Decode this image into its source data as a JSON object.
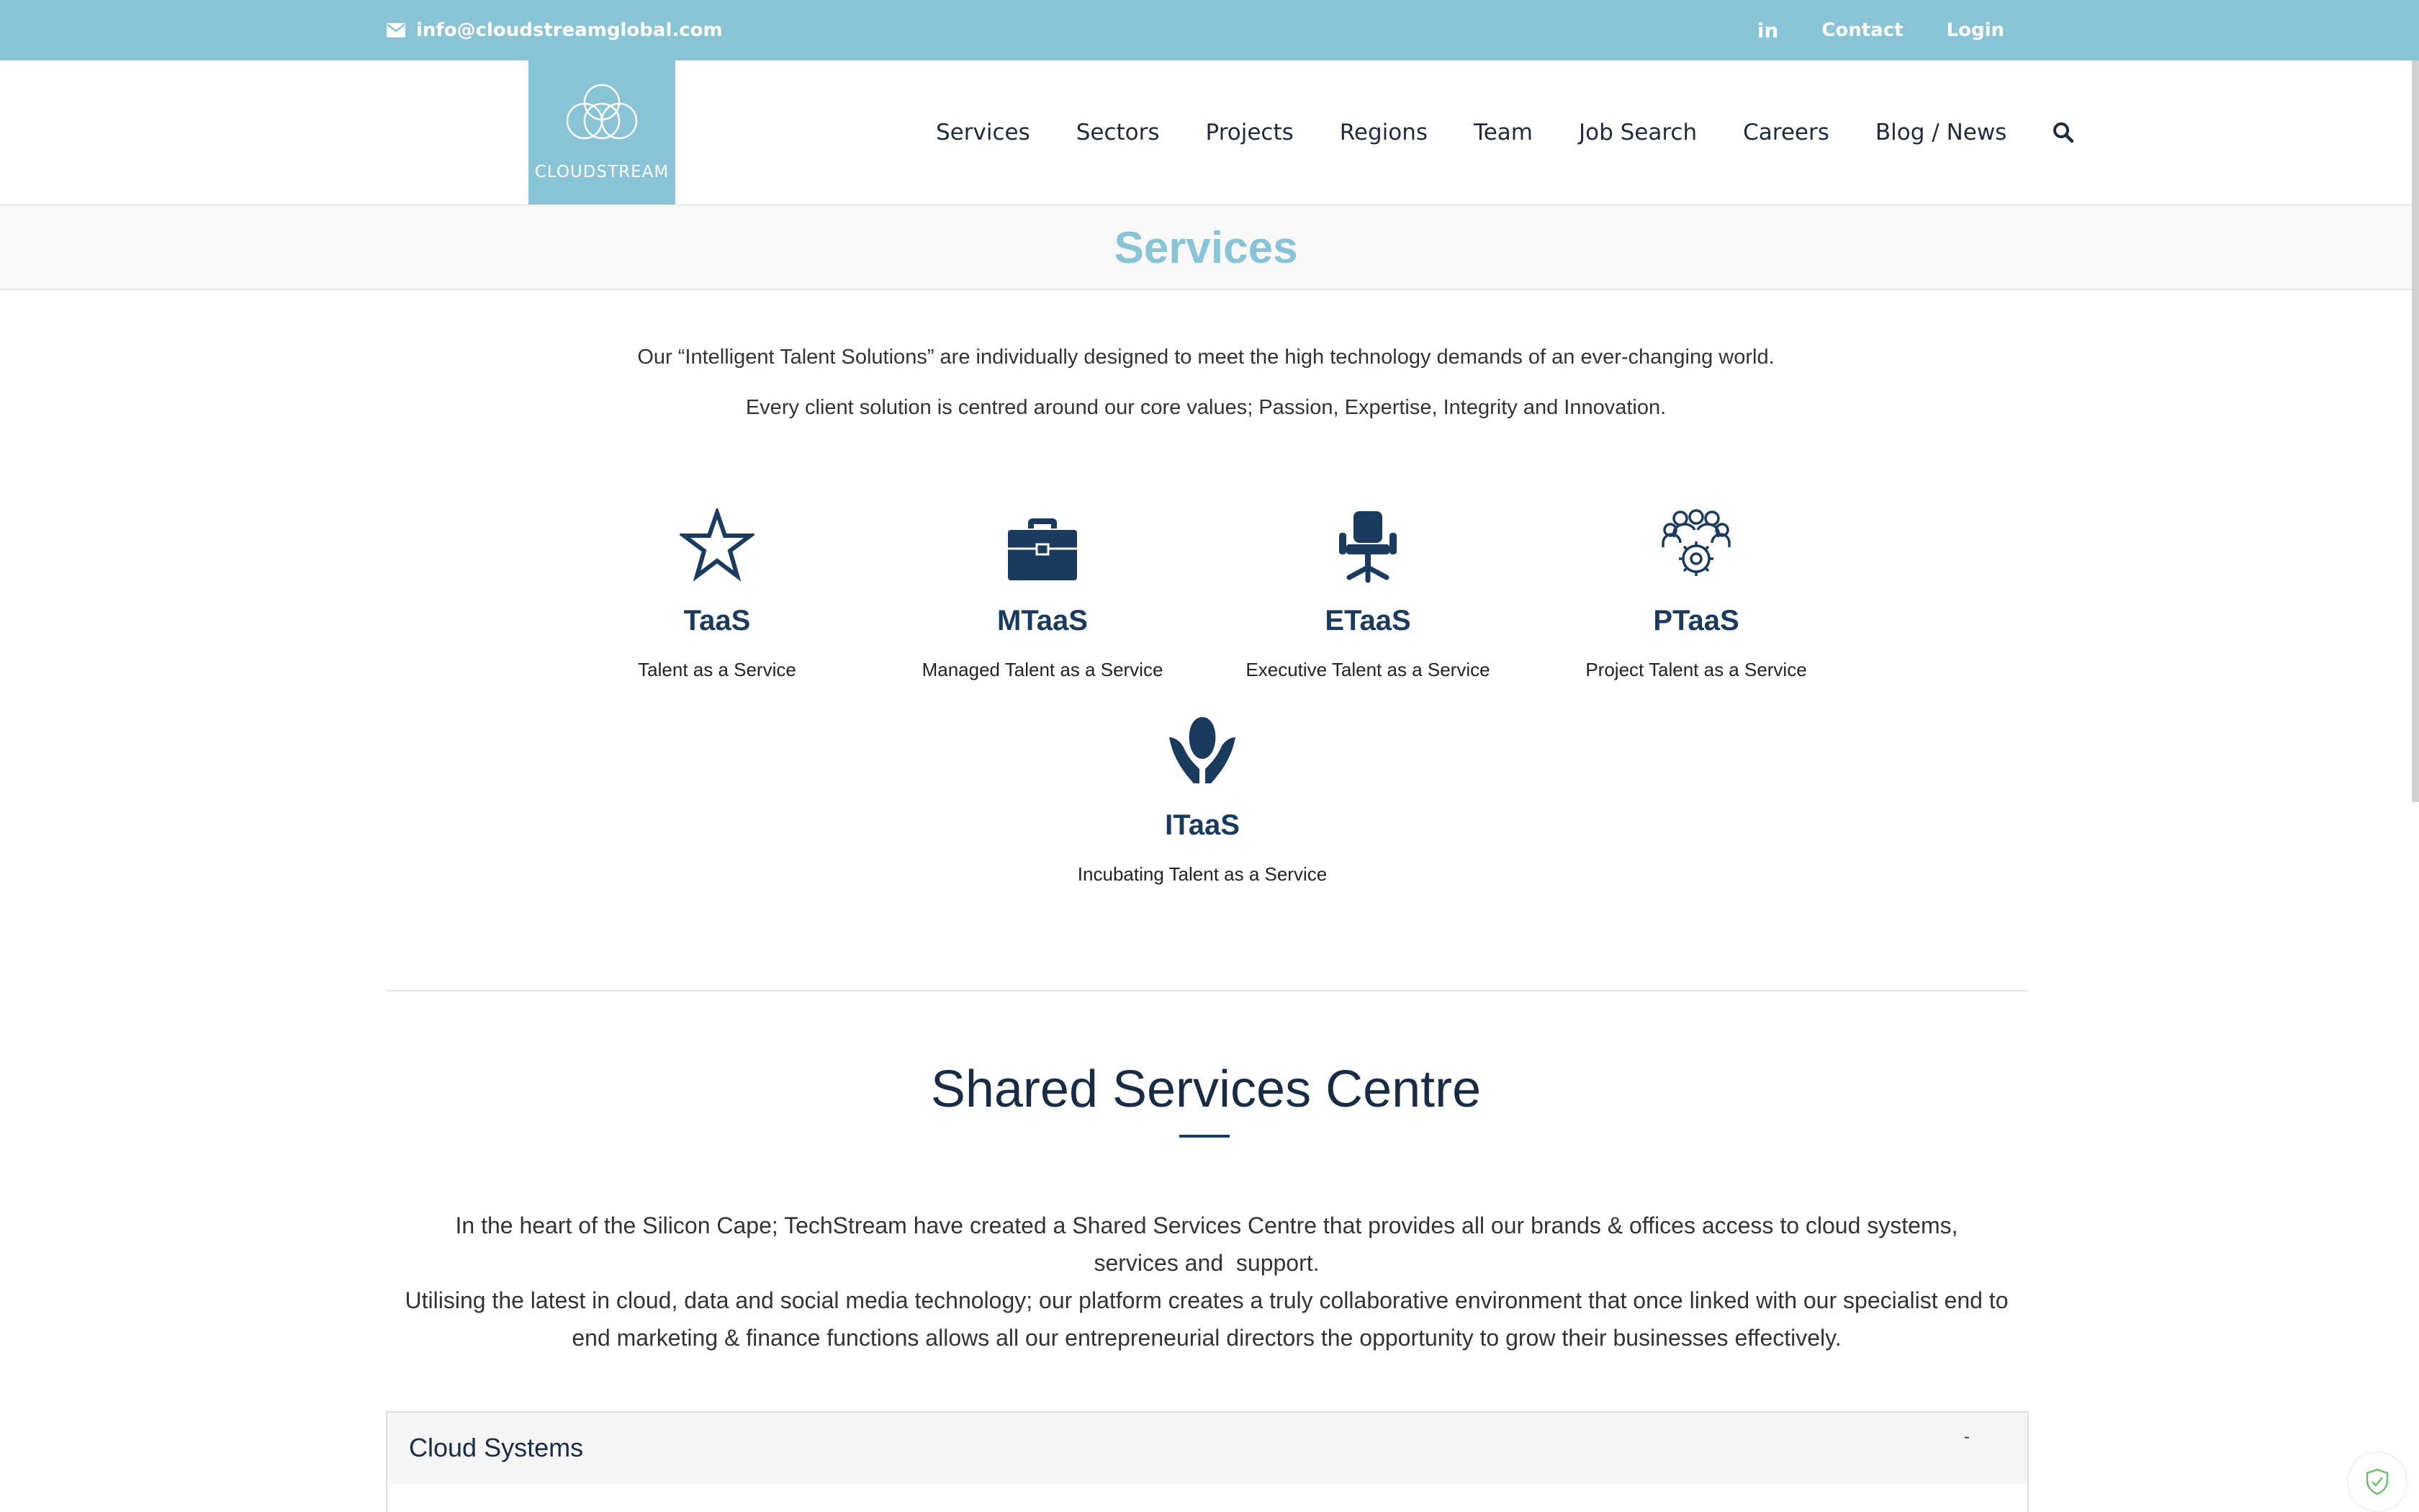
{
  "topbar": {
    "email": "info@cloudstreamglobal.com",
    "linkedin": "in",
    "contact": "Contact",
    "login": "Login"
  },
  "logo": {
    "text": "CLOUDSTREAM"
  },
  "nav": {
    "items": [
      "Services",
      "Sectors",
      "Projects",
      "Regions",
      "Team",
      "Job Search",
      "Careers",
      "Blog / News"
    ],
    "search_icon": "search-icon"
  },
  "page": {
    "title": "Services",
    "intro1": "Our “Intelligent Talent Solutions” are individually designed to meet the high technology demands of an ever-changing world.",
    "intro2": "Every client solution is centred around our core values; Passion, Expertise, Integrity and Innovation."
  },
  "services": [
    {
      "name": "TaaS",
      "desc": "Talent as a Service",
      "icon": "star-icon"
    },
    {
      "name": "MTaaS",
      "desc": "Managed Talent as a Service",
      "icon": "briefcase-icon"
    },
    {
      "name": "ETaaS",
      "desc": "Executive Talent as a Service",
      "icon": "office-chair-icon"
    },
    {
      "name": "PTaaS",
      "desc": "Project Talent as a Service",
      "icon": "team-gear-icon"
    },
    {
      "name": "ITaaS",
      "desc": "Incubating Talent as a Service",
      "icon": "hands-seed-icon"
    }
  ],
  "ssc": {
    "title": "Shared Services Centre",
    "para1_line1": "In the heart of the Silicon Cape; TechStream have created a Shared Services Centre that provides all our brands & offices access to cloud systems,",
    "para1_line2": "services and  support.",
    "para2_line1": "Utilising the latest in cloud, data and social media technology; our platform creates a truly collaborative environment that once linked with our specialist end to",
    "para2_line2": "end marketing & finance functions allows all our entrepreneurial directors the opportunity to grow their businesses effectively."
  },
  "accordion": {
    "label": "Cloud Systems",
    "toggle": "-"
  },
  "colors": {
    "accent": "#88c3d6",
    "navy": "#1a3a5e"
  }
}
